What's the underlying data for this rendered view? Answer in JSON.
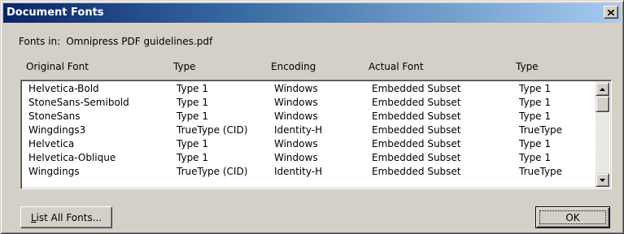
{
  "window": {
    "title": "Document Fonts"
  },
  "fonts_in": {
    "label": "Fonts in:",
    "file": "Omnipress PDF guidelines.pdf"
  },
  "columns": [
    "Original Font",
    "Type",
    "Encoding",
    "Actual Font",
    "Type"
  ],
  "rows": [
    [
      "Helvetica-Bold",
      "Type 1",
      "Windows",
      "Embedded Subset",
      "Type 1"
    ],
    [
      "StoneSans-Semibold",
      "Type 1",
      "Windows",
      "Embedded Subset",
      "Type 1"
    ],
    [
      "StoneSans",
      "Type 1",
      "Windows",
      "Embedded Subset",
      "Type 1"
    ],
    [
      "Wingdings3",
      "TrueType (CID)",
      "Identity-H",
      "Embedded Subset",
      "TrueType"
    ],
    [
      "Helvetica",
      "Type 1",
      "Windows",
      "Embedded Subset",
      "Type 1"
    ],
    [
      "Helvetica-Oblique",
      "Type 1",
      "Windows",
      "Embedded Subset",
      "Type 1"
    ],
    [
      "Wingdings",
      "TrueType (CID)",
      "Identity-H",
      "Embedded Subset",
      "TrueType"
    ]
  ],
  "buttons": {
    "list_all_accel": "L",
    "list_all_rest": "ist All Fonts...",
    "ok": "OK"
  },
  "icons": {
    "close": "close-icon",
    "scroll_up": "arrow-up-icon",
    "scroll_down": "arrow-down-icon"
  },
  "colors": {
    "titlebar_start": "#0a246a",
    "titlebar_end": "#a6caf0",
    "face": "#d4d0c8"
  }
}
